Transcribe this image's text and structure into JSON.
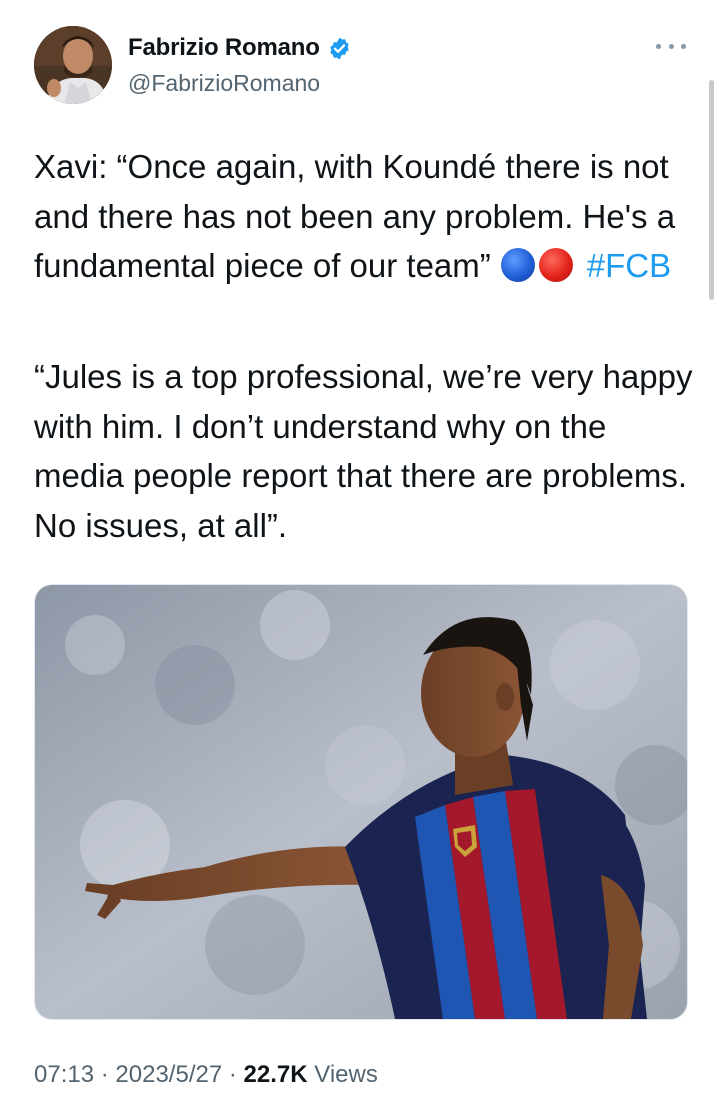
{
  "author": {
    "display_name": "Fabrizio Romano",
    "handle": "@FabrizioRomano",
    "verified": true,
    "avatar_icon": "profile-photo"
  },
  "menu": {
    "icon": "more-dots-icon"
  },
  "tweet": {
    "paragraph1_text": "Xavi: “Once again, with Koundé there is not and there has not been any problem. He's a fundamental piece of our team”",
    "emojis": [
      "blue-circle",
      "red-circle"
    ],
    "hashtag": "#FCB",
    "paragraph2_text": "“Jules is a top professional, we’re very happy with him. I don’t understand why on the media people report that there are problems. No issues, at all”."
  },
  "media": {
    "type": "photo",
    "subject": "football player in blue and red striped kit pointing"
  },
  "meta": {
    "time": "07:13",
    "separator": "·",
    "date": "2023/5/27",
    "views_count": "22.7K",
    "views_label": "Views"
  },
  "colors": {
    "link": "#1d9bf0",
    "secondary_text": "#536471",
    "primary_text": "#0f1419",
    "verified_badge": "#1d9bf0"
  }
}
